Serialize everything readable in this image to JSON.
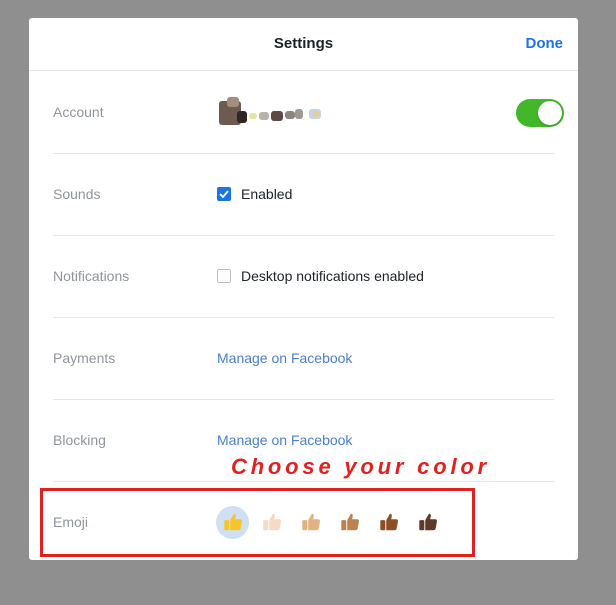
{
  "header": {
    "title": "Settings",
    "done_label": "Done"
  },
  "rows": {
    "account": {
      "label": "Account",
      "toggle_on": true
    },
    "sounds": {
      "label": "Sounds",
      "checkbox_label": "Enabled",
      "checked": true
    },
    "notifications": {
      "label": "Notifications",
      "checkbox_label": "Desktop notifications enabled",
      "checked": false
    },
    "payments": {
      "label": "Payments",
      "link": "Manage on Facebook"
    },
    "blocking": {
      "label": "Blocking",
      "link": "Manage on Facebook"
    },
    "emoji": {
      "label": "Emoji",
      "tones": [
        "#f7c52b",
        "#f7d9c4",
        "#e3b180",
        "#bd8252",
        "#8f4f24",
        "#5d3a29"
      ],
      "selected_index": 0
    }
  },
  "annotation": "Choose your color",
  "colors": {
    "accent": "#1b74e4",
    "toggle": "#42b72a",
    "annotation": "#e0211f"
  }
}
